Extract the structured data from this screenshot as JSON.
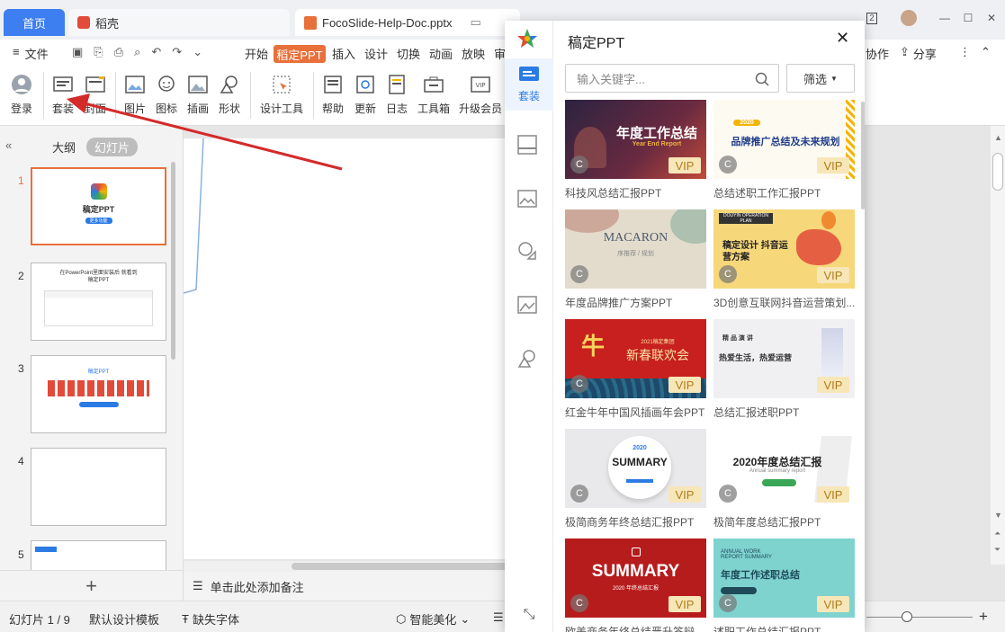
{
  "titlebar": {
    "tabs": [
      {
        "label": "首页"
      },
      {
        "label": "稻壳"
      },
      {
        "label": "FocoSlide-Help-Doc.pptx"
      }
    ],
    "badge_num": "2"
  },
  "menu": {
    "items": [
      "文件",
      "开始",
      "稻定PPT",
      "插入",
      "设计",
      "切换",
      "动画",
      "放映",
      "审"
    ],
    "right_items": [
      "协作",
      "分享"
    ]
  },
  "ribbon": {
    "buttons": [
      "登录",
      "套装",
      "封面",
      "图片",
      "图标",
      "插画",
      "形状",
      "设计工具",
      "帮助",
      "更新",
      "日志",
      "工具箱",
      "升级会员"
    ]
  },
  "left_panel": {
    "tabs": [
      "大纲",
      "幻灯片"
    ],
    "slides": [
      {
        "num": "1",
        "title": "稿定PPT",
        "sub": "更多功能"
      },
      {
        "num": "2",
        "title": "在PowerPoint里面安装后 就看到稿定PPT"
      },
      {
        "num": "3",
        "title": "稿定PPT"
      },
      {
        "num": "4"
      },
      {
        "num": "5"
      }
    ],
    "add": "+"
  },
  "notes": {
    "placeholder": "单击此处添加备注"
  },
  "status": {
    "slide_count": "幻灯片 1 / 9",
    "template": "默认设计模板",
    "font": "缺失字体",
    "beautify": "智能美化"
  },
  "panel": {
    "title": "稿定PPT",
    "rail": [
      "套装"
    ],
    "search_placeholder": "输入关键字...",
    "filter": "筛选",
    "vip": "VIP",
    "cards": [
      {
        "caption": "科技风总结汇报PPT",
        "title": "年度工作总结",
        "subtitle": "Year End Report"
      },
      {
        "caption": "总结述职工作汇报PPT",
        "title": "品牌推广总结及未来规划",
        "subtitle": "2020"
      },
      {
        "caption": "年度品牌推广方案PPT",
        "title": "MACARON",
        "subtitle": "序推荐 / 规划"
      },
      {
        "caption": "3D创意互联网抖音运营策划...",
        "title": "稿定设计 抖音运营方案",
        "subtitle": "DOUYIN OPERATION PLAN"
      },
      {
        "caption": "红金牛年中国风插画年会PPT",
        "title": "新春联欢会",
        "subtitle": "2021稿定集团"
      },
      {
        "caption": "总结汇报述职PPT",
        "title": "热爱生活，热爱运营",
        "subtitle": "精 品 演 讲"
      },
      {
        "caption": "极简商务年终总结汇报PPT",
        "title": "SUMMARY",
        "subtitle": "2020"
      },
      {
        "caption": "极简年度总结汇报PPT",
        "title": "2020年度总结汇报",
        "subtitle": "Annual summary report"
      },
      {
        "caption": "欧美商务年终总结晋升答辩...",
        "title": "SUMMARY",
        "subtitle": "2020 年终总结汇报"
      },
      {
        "caption": "述职工作总结汇报PPT",
        "title": "年度工作述职总结",
        "subtitle": "ANNUAL WORK REPORT SUMMARY"
      }
    ]
  },
  "colors": {
    "accent": "#e8703a",
    "home_tab": "#3d7ef0",
    "panel_blue": "#2b7be5",
    "arrow": "#d42a2a"
  }
}
